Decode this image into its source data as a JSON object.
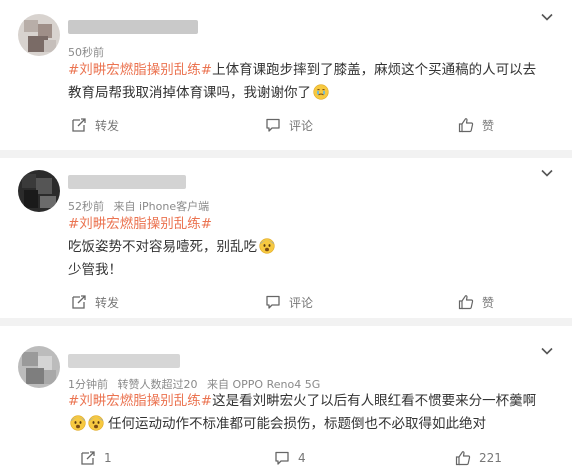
{
  "posts": [
    {
      "time": "50秒前",
      "source": "",
      "hashtag": "#刘畊宏燃脂操别乱练#",
      "text": "上体育课跑步摔到了膝盖，麻烦这个买通稿的人可以去教育局帮我取消掉体育课吗，我谢谢你了",
      "line2": "",
      "emoji": "crying-face",
      "actions": {
        "share": "转发",
        "comment": "评论",
        "like": "赞"
      }
    },
    {
      "time": "52秒前",
      "source": "来自 iPhone客户端",
      "hashtag": "#刘畊宏燃脂操别乱练#",
      "text": "吃饭姿势不对容易噎死，别乱吃",
      "line2": "少管我！",
      "emoji": "fearful-face",
      "actions": {
        "share": "转发",
        "comment": "评论",
        "like": "赞"
      }
    },
    {
      "time": "1分钟前",
      "likes_note": "转赞人数超过20",
      "source": "来自 OPPO Reno4 5G",
      "hashtag": "#刘畊宏燃脂操别乱练#",
      "text": "这是看刘畊宏火了以后有人眼红看不惯要来分一杯羹啊",
      "text_after": "任何运动动作不标准都可能会损伤，标题倒也不必取得如此绝对",
      "emoji": "fearful-face",
      "actions": {
        "share": "1",
        "comment": "4",
        "like": "221"
      }
    }
  ]
}
